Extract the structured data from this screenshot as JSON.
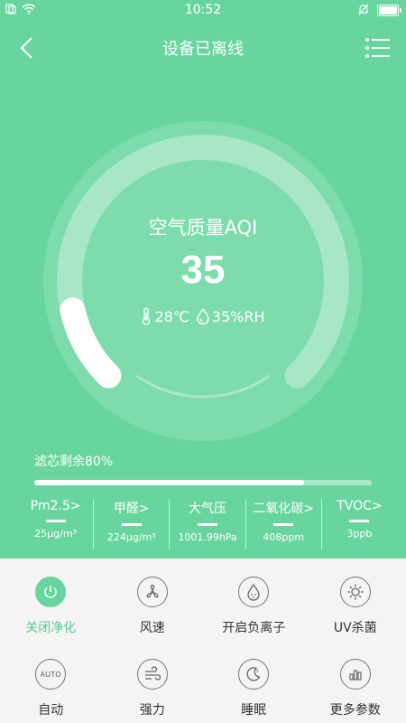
{
  "status_bar": {
    "time": "10:52"
  },
  "header": {
    "title": "设备已离线"
  },
  "aqi": {
    "label": "空气质量AQI",
    "value": "35",
    "temperature": "28℃",
    "humidity": "35%RH",
    "level_fraction": 0.12
  },
  "filter": {
    "label": "滤芯剩余80%",
    "remaining_fraction": 0.8
  },
  "metrics": [
    {
      "name": "Pm2.5>",
      "value": "25μg/m³"
    },
    {
      "name": "甲醛>",
      "value": "224μg/m³"
    },
    {
      "name": "大气压",
      "value": "1001.99hPa"
    },
    {
      "name": "二氧化碳>",
      "value": "408ppm"
    },
    {
      "name": "TVOC>",
      "value": "3ppb"
    }
  ],
  "controls": [
    {
      "label": "关闭净化",
      "icon": "power-icon",
      "active": true
    },
    {
      "label": "风速",
      "icon": "fan-icon",
      "active": false
    },
    {
      "label": "开启负离子",
      "icon": "ion-drop-icon",
      "active": false
    },
    {
      "label": "UV杀菌",
      "icon": "uv-sun-icon",
      "active": false
    },
    {
      "label": "自动",
      "icon": "auto-icon",
      "icon_text": "AUTO",
      "active": false
    },
    {
      "label": "强力",
      "icon": "wind-icon",
      "active": false
    },
    {
      "label": "睡眠",
      "icon": "moon-icon",
      "active": false
    },
    {
      "label": "更多参数",
      "icon": "bar-chart-icon",
      "active": false
    }
  ],
  "colors": {
    "primary": "#68d59f",
    "active_label": "#57c78d",
    "panel_bg": "#f4f4f4"
  }
}
